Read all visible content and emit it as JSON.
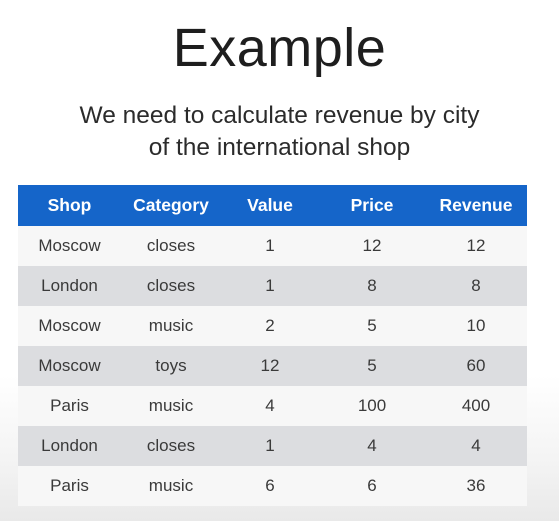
{
  "slide": {
    "title": "Example",
    "subtitle_lines": [
      "We need to calculate revenue by city",
      "of the international shop"
    ]
  },
  "table": {
    "headers": [
      "Shop",
      "Category",
      "Value",
      "Price",
      "Revenue"
    ],
    "rows": [
      [
        "Moscow",
        "closes",
        "1",
        "12",
        "12"
      ],
      [
        "London",
        "closes",
        "1",
        "8",
        "8"
      ],
      [
        "Moscow",
        "music",
        "2",
        "5",
        "10"
      ],
      [
        "Moscow",
        "toys",
        "12",
        "5",
        "60"
      ],
      [
        "Paris",
        "music",
        "4",
        "100",
        "400"
      ],
      [
        "London",
        "closes",
        "1",
        "4",
        "4"
      ],
      [
        "Paris",
        "music",
        "6",
        "6",
        "36"
      ]
    ]
  },
  "colors": {
    "header_bg": "#1565c9",
    "header_text": "#ffffff",
    "row_light": "#f7f7f7",
    "row_dark": "#dcdde0"
  }
}
